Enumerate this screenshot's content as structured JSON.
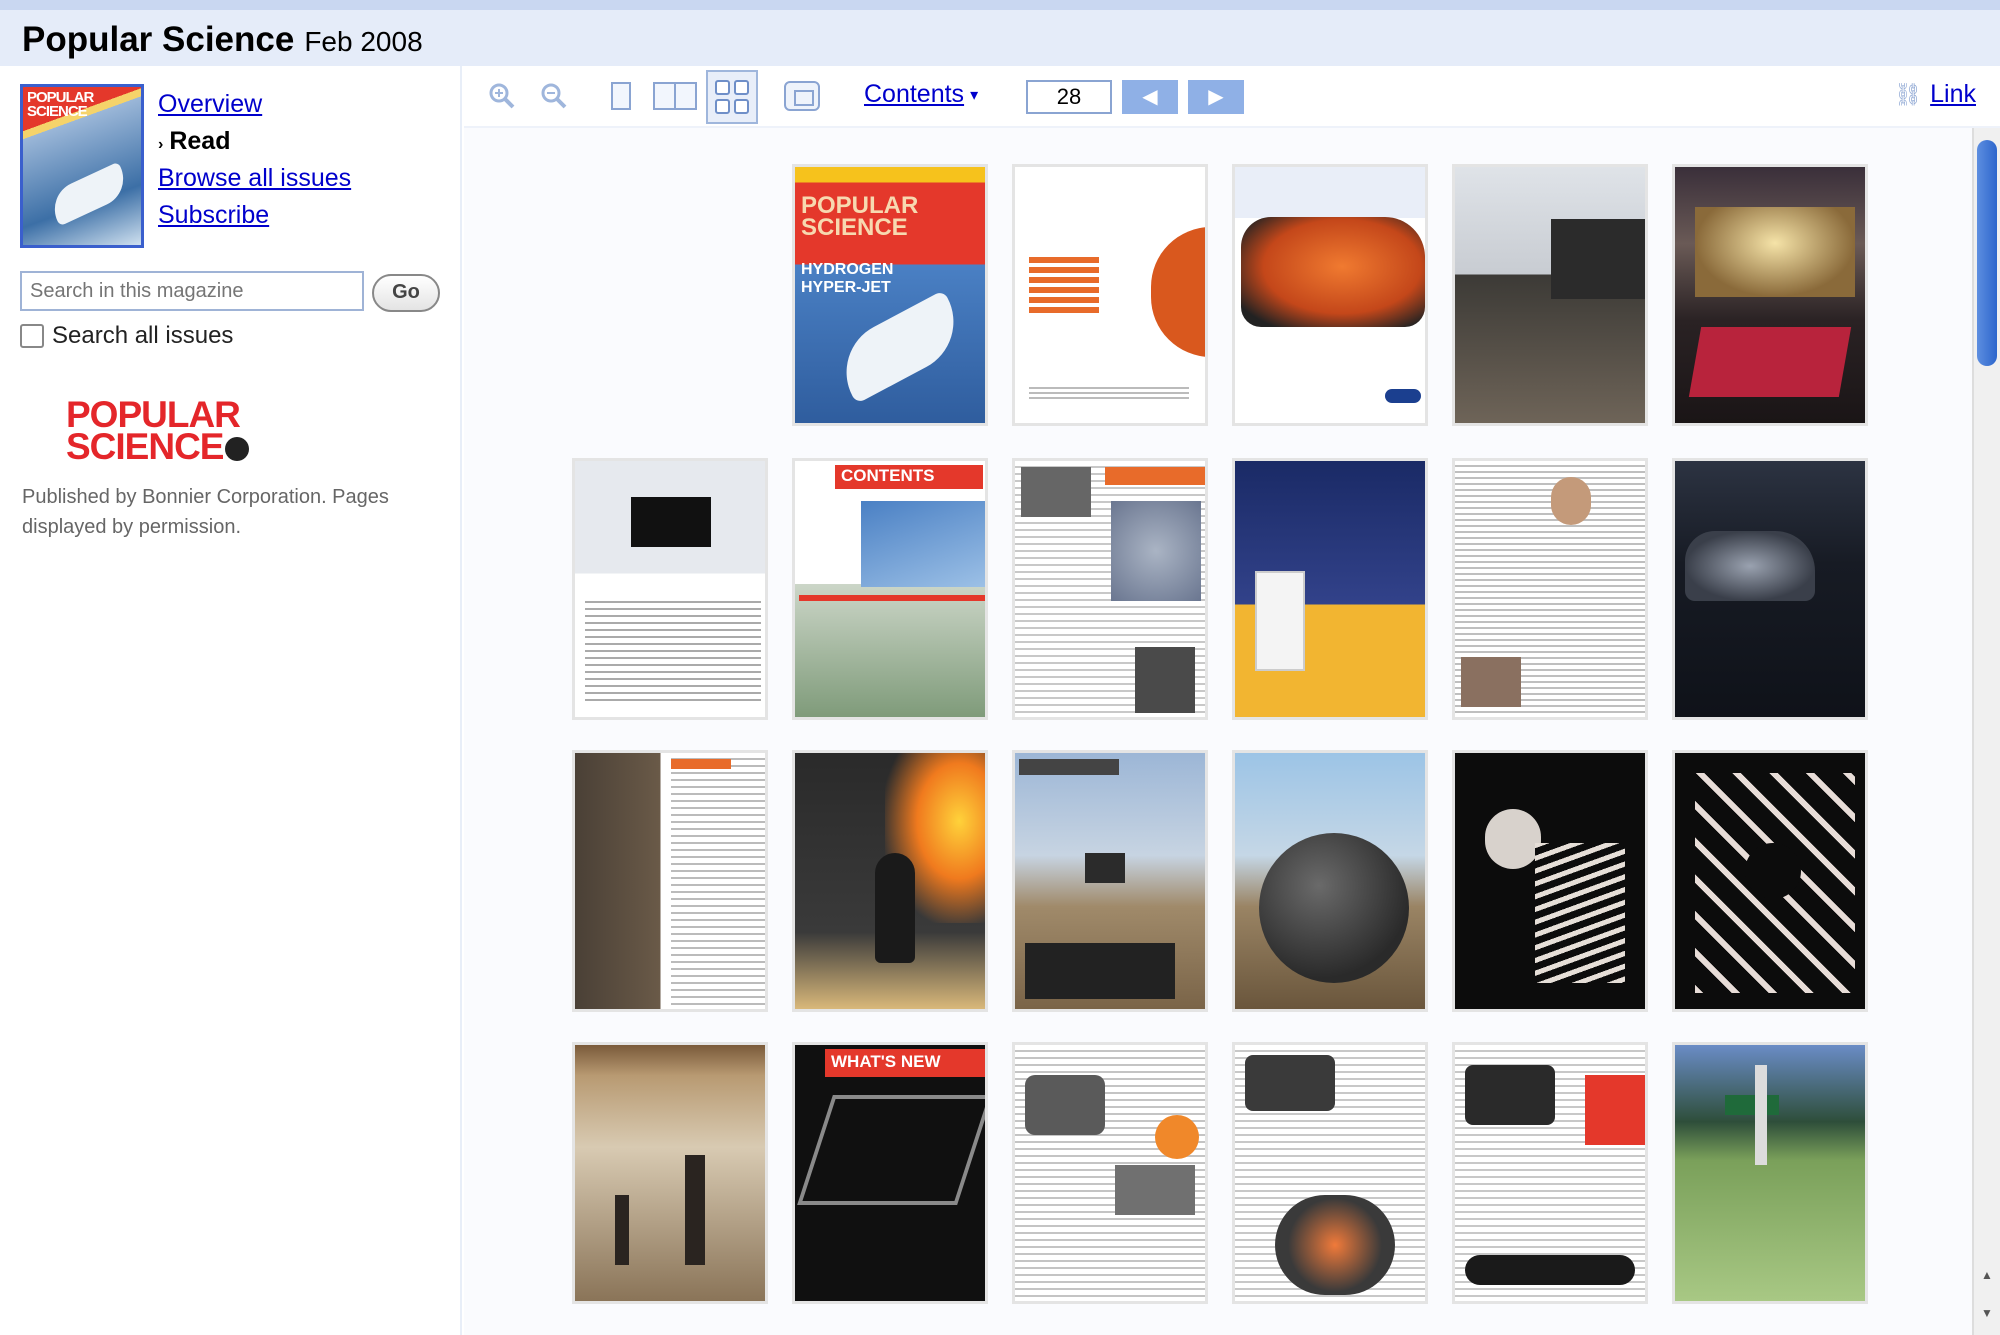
{
  "header": {
    "title": "Popular Science",
    "issue": "Feb 2008"
  },
  "sidebar": {
    "nav": [
      {
        "label": "Overview",
        "current": false
      },
      {
        "label": "Read",
        "current": true
      },
      {
        "label": "Browse all issues",
        "current": false
      },
      {
        "label": "Subscribe",
        "current": false
      }
    ],
    "search_placeholder": "Search in this magazine",
    "go_label": "Go",
    "search_all_label": "Search all issues",
    "search_all_checked": false,
    "logo": {
      "line1": "POPULAR",
      "line2": "SCIENCE"
    },
    "publisher_text": "Published by Bonnier Corporation. Pages displayed by permission."
  },
  "toolbar": {
    "icons": [
      "zoom-in-icon",
      "zoom-out-icon",
      "one-page-view-icon",
      "two-page-view-icon",
      "thumbnail-view-icon",
      "fullscreen-icon",
      "link-chain-icon"
    ],
    "active_view": "thumbnail",
    "contents_label": "Contents",
    "page_number": "28",
    "link_label": "Link"
  },
  "pages": {
    "cover": {
      "kicker": "POPULAR",
      "kicker2": "SCIENCE",
      "headline": "HYDROGEN",
      "headline2": "HYPER-JET"
    },
    "contents_page": {
      "title": "CONTENTS"
    },
    "whats_new_page": {
      "title": "WHAT'S NEW"
    }
  },
  "colors": {
    "link": "#0000cc",
    "header_bg": "#e5ecf9",
    "toolbar_icon": "#8aa4d2",
    "logo_red": "#e4262a",
    "scrollbar": "#2d66cc"
  }
}
